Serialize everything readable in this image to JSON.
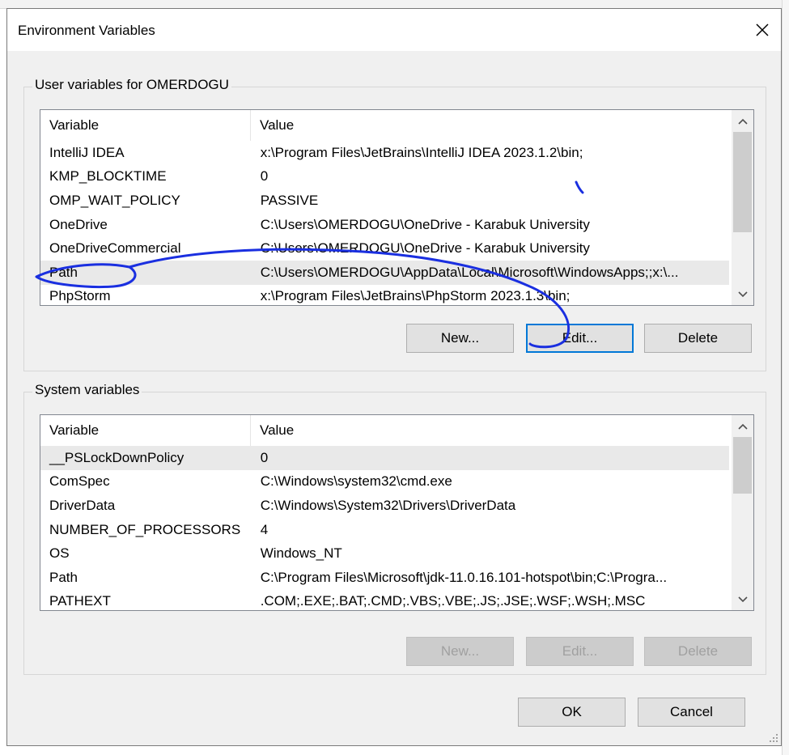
{
  "dialog": {
    "title": "Environment Variables"
  },
  "user_group": {
    "label": "User variables for OMERDOGU",
    "headers": [
      "Variable",
      "Value"
    ],
    "rows": [
      {
        "variable": "IntelliJ IDEA",
        "value": "x:\\Program Files\\JetBrains\\IntelliJ IDEA 2023.1.2\\bin;"
      },
      {
        "variable": "KMP_BLOCKTIME",
        "value": "0"
      },
      {
        "variable": "OMP_WAIT_POLICY",
        "value": "PASSIVE"
      },
      {
        "variable": "OneDrive",
        "value": "C:\\Users\\OMERDOGU\\OneDrive - Karabuk University"
      },
      {
        "variable": "OneDriveCommercial",
        "value": "C:\\Users\\OMERDOGU\\OneDrive - Karabuk University"
      },
      {
        "variable": "Path",
        "value": "C:\\Users\\OMERDOGU\\AppData\\Local\\Microsoft\\WindowsApps;;x:\\..."
      },
      {
        "variable": "PhpStorm",
        "value": "x:\\Program Files\\JetBrains\\PhpStorm 2023.1.3\\bin;"
      }
    ],
    "selected_row": "Path",
    "buttons": {
      "new": "New...",
      "edit": "Edit...",
      "delete": "Delete"
    }
  },
  "system_group": {
    "label": "System variables",
    "headers": [
      "Variable",
      "Value"
    ],
    "rows": [
      {
        "variable": "__PSLockDownPolicy",
        "value": "0"
      },
      {
        "variable": "ComSpec",
        "value": "C:\\Windows\\system32\\cmd.exe"
      },
      {
        "variable": "DriverData",
        "value": "C:\\Windows\\System32\\Drivers\\DriverData"
      },
      {
        "variable": "NUMBER_OF_PROCESSORS",
        "value": "4"
      },
      {
        "variable": "OS",
        "value": "Windows_NT"
      },
      {
        "variable": "Path",
        "value": "C:\\Program Files\\Microsoft\\jdk-11.0.16.101-hotspot\\bin;C:\\Progra..."
      },
      {
        "variable": "PATHEXT",
        "value": ".COM;.EXE;.BAT;.CMD;.VBS;.VBE;.JS;.JSE;.WSF;.WSH;.MSC"
      }
    ],
    "selected_row": "__PSLockDownPolicy",
    "buttons": {
      "new": "New...",
      "edit": "Edit...",
      "delete": "Delete"
    },
    "buttons_disabled": true
  },
  "footer": {
    "ok": "OK",
    "cancel": "Cancel"
  },
  "colors": {
    "annotation_ink": "#1a2fe0",
    "default_button_border": "#0078d7"
  },
  "icons": {
    "close": "close-icon",
    "scroll_up": "chevron-up-icon",
    "scroll_down": "chevron-down-icon",
    "resize": "resize-grip-icon"
  }
}
